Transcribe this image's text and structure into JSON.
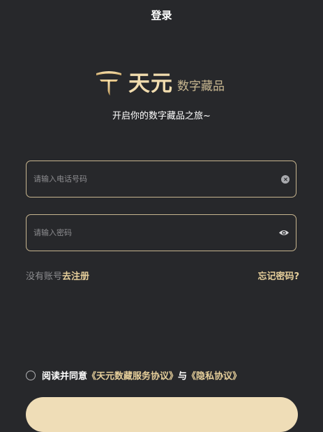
{
  "header": {
    "title": "登录"
  },
  "brand": {
    "name": "天元",
    "subtitle": "数字藏品",
    "tagline": "开启你的数字藏品之旅~",
    "accent_color": "#f1dcae"
  },
  "form": {
    "phone": {
      "placeholder": "请输入电话号码",
      "value": "",
      "action_icon": "clear-icon"
    },
    "password": {
      "placeholder": "请输入密码",
      "value": "",
      "action_icon": "eye-icon"
    }
  },
  "links": {
    "no_account": "没有账号",
    "register": "去注册",
    "forgot_password": "忘记密码?"
  },
  "agreement": {
    "checked": false,
    "prefix": "阅读并同意",
    "service_link": "《天元数藏服务协议》",
    "connector": "与",
    "privacy_link": "《隐私协议》"
  },
  "colors": {
    "background": "#27282b",
    "gold": "#e6cf9b",
    "field_border": "#c7b58f"
  }
}
